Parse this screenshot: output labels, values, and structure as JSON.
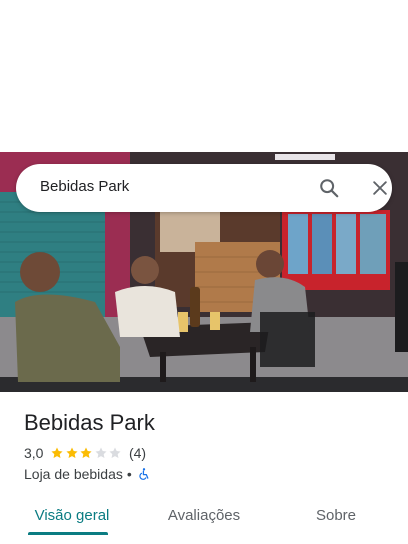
{
  "search": {
    "query": "Bebidas Park",
    "search_icon": "search-icon",
    "close_icon": "close-icon"
  },
  "photo": {
    "description_icon": "place-photo"
  },
  "place": {
    "name": "Bebidas Park",
    "rating": "3,0",
    "rating_value": 3,
    "rating_max": 5,
    "review_count": "(4)",
    "category": "Loja de bebidas",
    "separator": "•",
    "accessibility_icon": "wheelchair-icon"
  },
  "tabs": [
    {
      "label": "Visão geral",
      "active": true
    },
    {
      "label": "Avaliações",
      "active": false
    },
    {
      "label": "Sobre",
      "active": false
    }
  ],
  "colors": {
    "accent": "#0b7c82",
    "star_filled": "#fbbc04",
    "star_empty": "#dadce0",
    "accessibility": "#1a73e8"
  }
}
